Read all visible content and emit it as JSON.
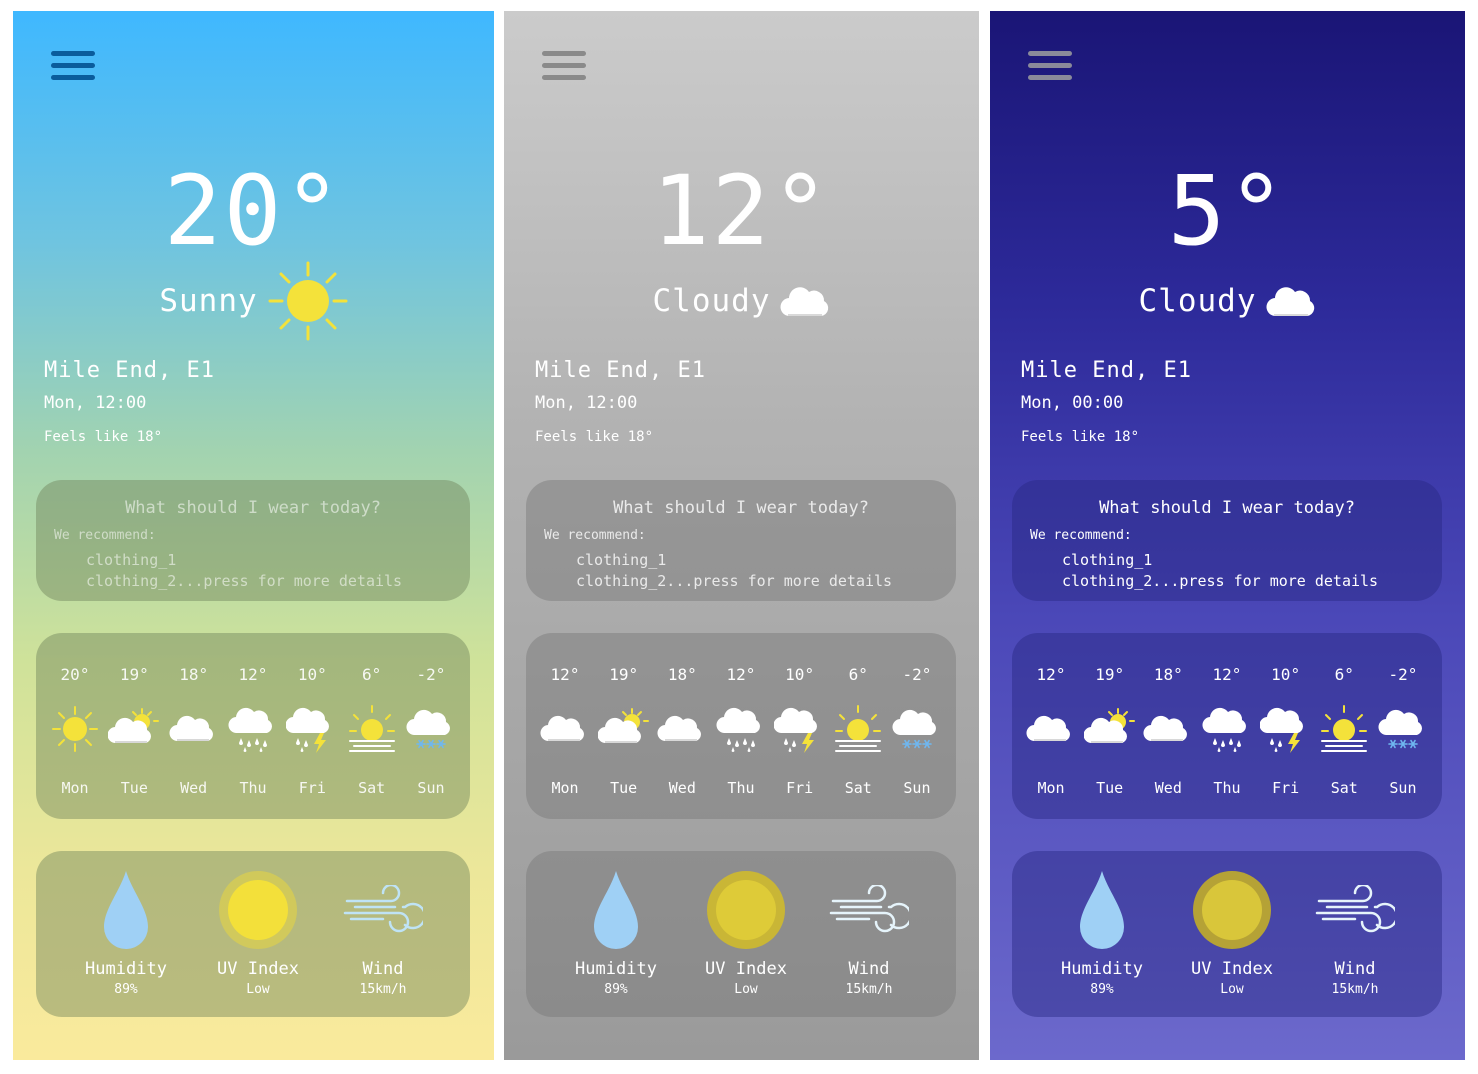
{
  "screens": [
    {
      "temperature": "20°",
      "condition": "Sunny",
      "condition_icon": "sun-icon",
      "location": "Mile End, E1",
      "datetime": "Mon, 12:00",
      "feels_like": "Feels like 18°",
      "wear": {
        "title": "What should I wear today?",
        "recommend": "We recommend:",
        "item1": "clothing_1",
        "item2": "clothing_2...press for more details"
      },
      "forecast": [
        {
          "temp": "20°",
          "day": "Mon",
          "icon": "sun-icon"
        },
        {
          "temp": "19°",
          "day": "Tue",
          "icon": "partly-cloudy-icon"
        },
        {
          "temp": "18°",
          "day": "Wed",
          "icon": "cloud-icon"
        },
        {
          "temp": "12°",
          "day": "Thu",
          "icon": "rain-icon"
        },
        {
          "temp": "10°",
          "day": "Fri",
          "icon": "storm-icon"
        },
        {
          "temp": "6°",
          "day": "Sat",
          "icon": "hazy-sun-icon"
        },
        {
          "temp": "-2°",
          "day": "Sun",
          "icon": "snow-icon"
        }
      ],
      "stats": {
        "humidity_label": "Humidity",
        "humidity_value": "89%",
        "uv_label": "UV Index",
        "uv_value": "Low",
        "wind_label": "Wind",
        "wind_value": "15km/h"
      },
      "colors": {
        "menu": "#0a5c9c",
        "text": "#ffffff"
      }
    },
    {
      "temperature": "12°",
      "condition": "Cloudy",
      "condition_icon": "cloud-icon",
      "location": "Mile End, E1",
      "datetime": "Mon, 12:00",
      "feels_like": "Feels like 18°",
      "wear": {
        "title": "What should I wear today?",
        "recommend": "We recommend:",
        "item1": "clothing_1",
        "item2": "clothing_2...press for more details"
      },
      "forecast": [
        {
          "temp": "12°",
          "day": "Mon",
          "icon": "cloud-icon"
        },
        {
          "temp": "19°",
          "day": "Tue",
          "icon": "partly-cloudy-icon"
        },
        {
          "temp": "18°",
          "day": "Wed",
          "icon": "cloud-icon"
        },
        {
          "temp": "12°",
          "day": "Thu",
          "icon": "rain-icon"
        },
        {
          "temp": "10°",
          "day": "Fri",
          "icon": "storm-icon"
        },
        {
          "temp": "6°",
          "day": "Sat",
          "icon": "hazy-sun-icon"
        },
        {
          "temp": "-2°",
          "day": "Sun",
          "icon": "snow-icon"
        }
      ],
      "stats": {
        "humidity_label": "Humidity",
        "humidity_value": "89%",
        "uv_label": "UV Index",
        "uv_value": "Low",
        "wind_label": "Wind",
        "wind_value": "15km/h"
      },
      "colors": {
        "menu": "#8a8a8a",
        "text": "#ffffff"
      }
    },
    {
      "temperature": "5°",
      "condition": "Cloudy",
      "condition_icon": "cloud-icon",
      "location": "Mile End, E1",
      "datetime": "Mon, 00:00",
      "feels_like": "Feels like 18°",
      "wear": {
        "title": "What should I wear today?",
        "recommend": "We recommend:",
        "item1": "clothing_1",
        "item2": "clothing_2...press for more details"
      },
      "forecast": [
        {
          "temp": "12°",
          "day": "Mon",
          "icon": "cloud-icon"
        },
        {
          "temp": "19°",
          "day": "Tue",
          "icon": "partly-cloudy-icon"
        },
        {
          "temp": "18°",
          "day": "Wed",
          "icon": "cloud-icon"
        },
        {
          "temp": "12°",
          "day": "Thu",
          "icon": "rain-icon"
        },
        {
          "temp": "10°",
          "day": "Fri",
          "icon": "storm-icon"
        },
        {
          "temp": "6°",
          "day": "Sat",
          "icon": "hazy-sun-icon"
        },
        {
          "temp": "-2°",
          "day": "Sun",
          "icon": "snow-icon"
        }
      ],
      "stats": {
        "humidity_label": "Humidity",
        "humidity_value": "89%",
        "uv_label": "UV Index",
        "uv_value": "Low",
        "wind_label": "Wind",
        "wind_value": "15km/h"
      },
      "colors": {
        "menu": "#8a8a9a",
        "text": "#ffffff"
      }
    }
  ]
}
